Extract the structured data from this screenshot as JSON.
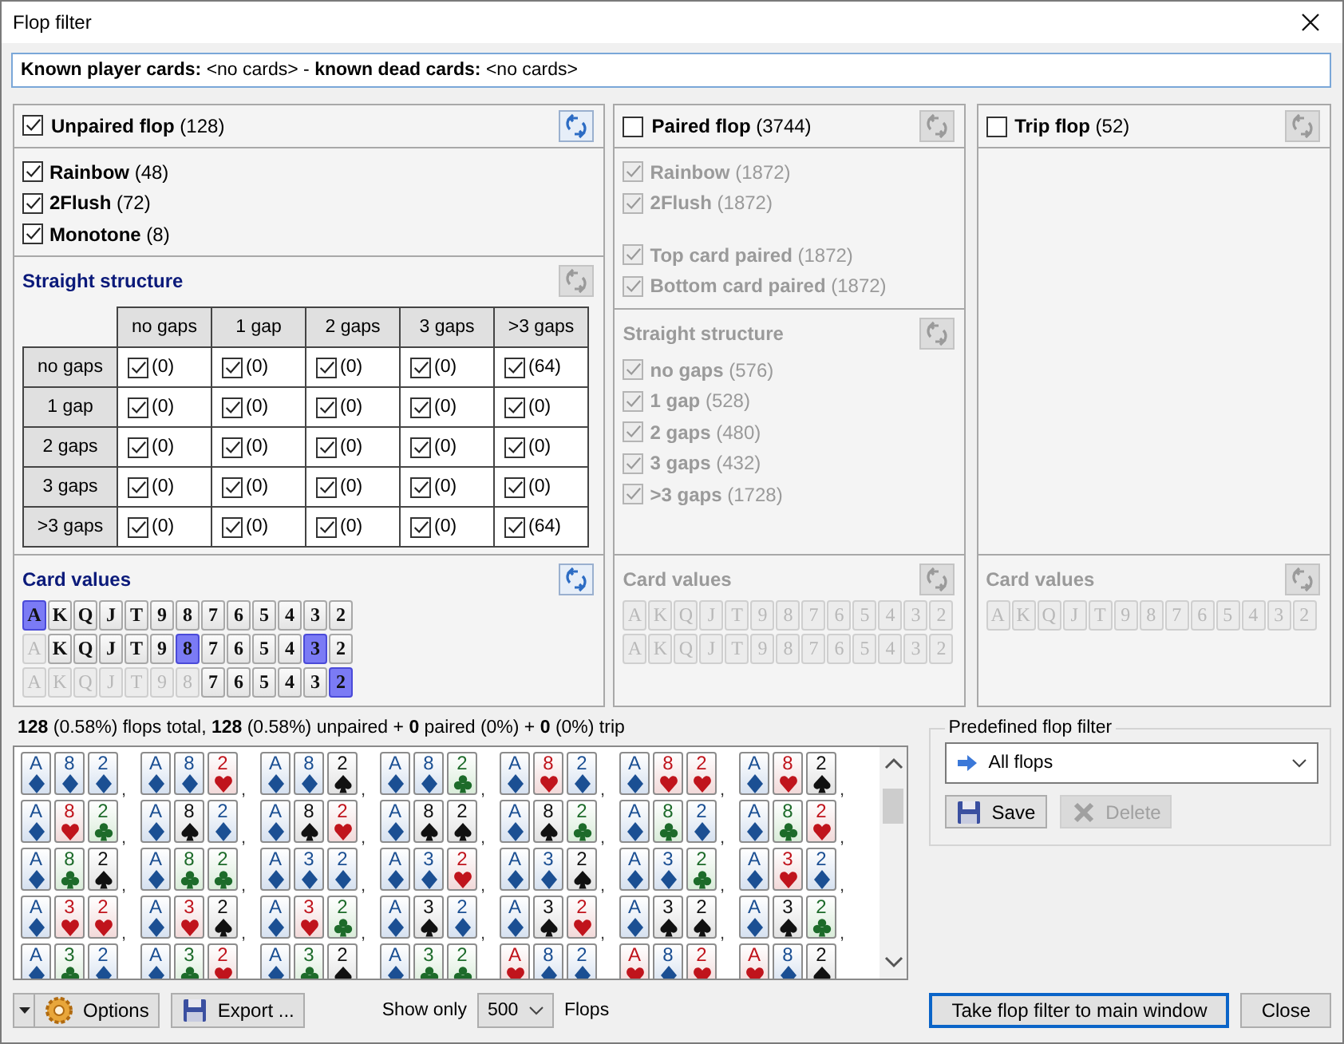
{
  "window": {
    "title": "Flop filter"
  },
  "known_cards": "**Known player cards:** <no cards> - **known dead cards:** <no cards>",
  "panels": [
    {
      "title": "Unpaired flop",
      "count": "(128)",
      "checked": true,
      "refresh_disabled": false,
      "option_groups": [
        [
          {
            "label": "Rainbow",
            "count": "(48)",
            "checked": true,
            "disabled": false
          },
          {
            "label": "2Flush",
            "count": "(72)",
            "checked": true,
            "disabled": false
          },
          {
            "label": "Monotone",
            "count": "(8)",
            "checked": true,
            "disabled": false
          }
        ]
      ],
      "straight": {
        "kind": "grid",
        "title": "Straight structure",
        "disabled": false,
        "refresh_disabled": true,
        "columns": [
          "no gaps",
          "1 gap",
          "2 gaps",
          "3 gaps",
          ">3 gaps"
        ],
        "rows": [
          {
            "label": "no gaps",
            "cells": [
              {
                "checked": true,
                "count": "(0)"
              },
              {
                "checked": true,
                "count": "(0)"
              },
              {
                "checked": true,
                "count": "(0)"
              },
              {
                "checked": true,
                "count": "(0)"
              },
              {
                "checked": true,
                "count": "(64)"
              }
            ]
          },
          {
            "label": "1 gap",
            "cells": [
              {
                "checked": true,
                "count": "(0)"
              },
              {
                "checked": true,
                "count": "(0)"
              },
              {
                "checked": true,
                "count": "(0)"
              },
              {
                "checked": true,
                "count": "(0)"
              },
              {
                "checked": true,
                "count": "(0)"
              }
            ]
          },
          {
            "label": "2 gaps",
            "cells": [
              {
                "checked": true,
                "count": "(0)"
              },
              {
                "checked": true,
                "count": "(0)"
              },
              {
                "checked": true,
                "count": "(0)"
              },
              {
                "checked": true,
                "count": "(0)"
              },
              {
                "checked": true,
                "count": "(0)"
              }
            ]
          },
          {
            "label": "3 gaps",
            "cells": [
              {
                "checked": true,
                "count": "(0)"
              },
              {
                "checked": true,
                "count": "(0)"
              },
              {
                "checked": true,
                "count": "(0)"
              },
              {
                "checked": true,
                "count": "(0)"
              },
              {
                "checked": true,
                "count": "(0)"
              }
            ]
          },
          {
            "label": ">3 gaps",
            "cells": [
              {
                "checked": true,
                "count": "(0)"
              },
              {
                "checked": true,
                "count": "(0)"
              },
              {
                "checked": true,
                "count": "(0)"
              },
              {
                "checked": true,
                "count": "(0)"
              },
              {
                "checked": true,
                "count": "(64)"
              }
            ]
          }
        ]
      },
      "card_values": {
        "title": "Card values",
        "disabled": false,
        "refresh_disabled": false,
        "rows": [
          [
            {
              "label": "A",
              "selected": true,
              "disabled": false
            },
            {
              "label": "K",
              "selected": false,
              "disabled": false
            },
            {
              "label": "Q",
              "selected": false,
              "disabled": false
            },
            {
              "label": "J",
              "selected": false,
              "disabled": false
            },
            {
              "label": "T",
              "selected": false,
              "disabled": false
            },
            {
              "label": "9",
              "selected": false,
              "disabled": false
            },
            {
              "label": "8",
              "selected": false,
              "disabled": false
            },
            {
              "label": "7",
              "selected": false,
              "disabled": false
            },
            {
              "label": "6",
              "selected": false,
              "disabled": false
            },
            {
              "label": "5",
              "selected": false,
              "disabled": false
            },
            {
              "label": "4",
              "selected": false,
              "disabled": false
            },
            {
              "label": "3",
              "selected": false,
              "disabled": false
            },
            {
              "label": "2",
              "selected": false,
              "disabled": false
            }
          ],
          [
            {
              "label": "A",
              "selected": false,
              "disabled": true
            },
            {
              "label": "K",
              "selected": false,
              "disabled": false
            },
            {
              "label": "Q",
              "selected": false,
              "disabled": false
            },
            {
              "label": "J",
              "selected": false,
              "disabled": false
            },
            {
              "label": "T",
              "selected": false,
              "disabled": false
            },
            {
              "label": "9",
              "selected": false,
              "disabled": false
            },
            {
              "label": "8",
              "selected": true,
              "disabled": false
            },
            {
              "label": "7",
              "selected": false,
              "disabled": false
            },
            {
              "label": "6",
              "selected": false,
              "disabled": false
            },
            {
              "label": "5",
              "selected": false,
              "disabled": false
            },
            {
              "label": "4",
              "selected": false,
              "disabled": false
            },
            {
              "label": "3",
              "selected": true,
              "disabled": false
            },
            {
              "label": "2",
              "selected": false,
              "disabled": false
            }
          ],
          [
            {
              "label": "A",
              "selected": false,
              "disabled": true
            },
            {
              "label": "K",
              "selected": false,
              "disabled": true
            },
            {
              "label": "Q",
              "selected": false,
              "disabled": true
            },
            {
              "label": "J",
              "selected": false,
              "disabled": true
            },
            {
              "label": "T",
              "selected": false,
              "disabled": true
            },
            {
              "label": "9",
              "selected": false,
              "disabled": true
            },
            {
              "label": "8",
              "selected": false,
              "disabled": true
            },
            {
              "label": "7",
              "selected": false,
              "disabled": false
            },
            {
              "label": "6",
              "selected": false,
              "disabled": false
            },
            {
              "label": "5",
              "selected": false,
              "disabled": false
            },
            {
              "label": "4",
              "selected": false,
              "disabled": false
            },
            {
              "label": "3",
              "selected": false,
              "disabled": false
            },
            {
              "label": "2",
              "selected": true,
              "disabled": false
            }
          ]
        ]
      }
    },
    {
      "title": "Paired flop",
      "count": "(3744)",
      "checked": false,
      "refresh_disabled": true,
      "option_groups": [
        [
          {
            "label": "Rainbow",
            "count": "(1872)",
            "checked": true,
            "disabled": true
          },
          {
            "label": "2Flush",
            "count": "(1872)",
            "checked": true,
            "disabled": true
          }
        ],
        [
          {
            "label": "Top card paired",
            "count": "(1872)",
            "checked": true,
            "disabled": true
          },
          {
            "label": "Bottom card paired",
            "count": "(1872)",
            "checked": true,
            "disabled": true
          }
        ]
      ],
      "straight": {
        "kind": "list",
        "title": "Straight structure",
        "disabled": true,
        "refresh_disabled": true,
        "items": [
          {
            "label": "no gaps",
            "count": "(576)",
            "checked": true,
            "disabled": true
          },
          {
            "label": "1 gap",
            "count": "(528)",
            "checked": true,
            "disabled": true
          },
          {
            "label": "2 gaps",
            "count": "(480)",
            "checked": true,
            "disabled": true
          },
          {
            "label": "3 gaps",
            "count": "(432)",
            "checked": true,
            "disabled": true
          },
          {
            "label": ">3 gaps",
            "count": "(1728)",
            "checked": true,
            "disabled": true
          }
        ]
      },
      "card_values": {
        "title": "Card values",
        "disabled": true,
        "refresh_disabled": true,
        "rows": [
          [
            {
              "label": "A",
              "selected": false,
              "disabled": true
            },
            {
              "label": "K",
              "selected": false,
              "disabled": true
            },
            {
              "label": "Q",
              "selected": false,
              "disabled": true
            },
            {
              "label": "J",
              "selected": false,
              "disabled": true
            },
            {
              "label": "T",
              "selected": false,
              "disabled": true
            },
            {
              "label": "9",
              "selected": false,
              "disabled": true
            },
            {
              "label": "8",
              "selected": false,
              "disabled": true
            },
            {
              "label": "7",
              "selected": false,
              "disabled": true
            },
            {
              "label": "6",
              "selected": false,
              "disabled": true
            },
            {
              "label": "5",
              "selected": false,
              "disabled": true
            },
            {
              "label": "4",
              "selected": false,
              "disabled": true
            },
            {
              "label": "3",
              "selected": false,
              "disabled": true
            },
            {
              "label": "2",
              "selected": false,
              "disabled": true
            }
          ],
          [
            {
              "label": "A",
              "selected": false,
              "disabled": true
            },
            {
              "label": "K",
              "selected": false,
              "disabled": true
            },
            {
              "label": "Q",
              "selected": false,
              "disabled": true
            },
            {
              "label": "J",
              "selected": false,
              "disabled": true
            },
            {
              "label": "T",
              "selected": false,
              "disabled": true
            },
            {
              "label": "9",
              "selected": false,
              "disabled": true
            },
            {
              "label": "8",
              "selected": false,
              "disabled": true
            },
            {
              "label": "7",
              "selected": false,
              "disabled": true
            },
            {
              "label": "6",
              "selected": false,
              "disabled": true
            },
            {
              "label": "5",
              "selected": false,
              "disabled": true
            },
            {
              "label": "4",
              "selected": false,
              "disabled": true
            },
            {
              "label": "3",
              "selected": false,
              "disabled": true
            },
            {
              "label": "2",
              "selected": false,
              "disabled": true
            }
          ]
        ]
      }
    },
    {
      "title": "Trip flop",
      "count": "(52)",
      "checked": false,
      "refresh_disabled": true,
      "card_values": {
        "title": "Card values",
        "disabled": true,
        "refresh_disabled": true,
        "rows": [
          [
            {
              "label": "A",
              "selected": false,
              "disabled": true
            },
            {
              "label": "K",
              "selected": false,
              "disabled": true
            },
            {
              "label": "Q",
              "selected": false,
              "disabled": true
            },
            {
              "label": "J",
              "selected": false,
              "disabled": true
            },
            {
              "label": "T",
              "selected": false,
              "disabled": true
            },
            {
              "label": "9",
              "selected": false,
              "disabled": true
            },
            {
              "label": "8",
              "selected": false,
              "disabled": true
            },
            {
              "label": "7",
              "selected": false,
              "disabled": true
            },
            {
              "label": "6",
              "selected": false,
              "disabled": true
            },
            {
              "label": "5",
              "selected": false,
              "disabled": true
            },
            {
              "label": "4",
              "selected": false,
              "disabled": true
            },
            {
              "label": "3",
              "selected": false,
              "disabled": true
            },
            {
              "label": "2",
              "selected": false,
              "disabled": true
            }
          ]
        ]
      }
    }
  ],
  "summary": "**128** (0.58%) flops total, **128** (0.58%) unpaired + **0** paired (0%) + **0** (0%) trip",
  "flop_list": {
    "rows": [
      [
        {
          "separator": ",",
          "cards": [
            {
              "rank": "A",
              "kind": "diamond"
            },
            {
              "rank": "8",
              "kind": "diamond"
            },
            {
              "rank": "2",
              "kind": "diamond"
            }
          ]
        },
        {
          "separator": ",",
          "cards": [
            {
              "rank": "A",
              "kind": "diamond"
            },
            {
              "rank": "8",
              "kind": "diamond"
            },
            {
              "rank": "2",
              "kind": "heart"
            }
          ]
        },
        {
          "separator": ",",
          "cards": [
            {
              "rank": "A",
              "kind": "diamond"
            },
            {
              "rank": "8",
              "kind": "diamond"
            },
            {
              "rank": "2",
              "kind": "spade"
            }
          ]
        },
        {
          "separator": ",",
          "cards": [
            {
              "rank": "A",
              "kind": "diamond"
            },
            {
              "rank": "8",
              "kind": "diamond"
            },
            {
              "rank": "2",
              "kind": "club"
            }
          ]
        },
        {
          "separator": ",",
          "cards": [
            {
              "rank": "A",
              "kind": "diamond"
            },
            {
              "rank": "8",
              "kind": "heart"
            },
            {
              "rank": "2",
              "kind": "diamond"
            }
          ]
        },
        {
          "separator": ",",
          "cards": [
            {
              "rank": "A",
              "kind": "diamond"
            },
            {
              "rank": "8",
              "kind": "heart"
            },
            {
              "rank": "2",
              "kind": "heart"
            }
          ]
        },
        {
          "separator": ",",
          "cards": [
            {
              "rank": "A",
              "kind": "diamond"
            },
            {
              "rank": "8",
              "kind": "heart"
            },
            {
              "rank": "2",
              "kind": "spade"
            }
          ]
        }
      ],
      [
        {
          "separator": ",",
          "cards": [
            {
              "rank": "A",
              "kind": "diamond"
            },
            {
              "rank": "8",
              "kind": "heart"
            },
            {
              "rank": "2",
              "kind": "club"
            }
          ]
        },
        {
          "separator": ",",
          "cards": [
            {
              "rank": "A",
              "kind": "diamond"
            },
            {
              "rank": "8",
              "kind": "spade"
            },
            {
              "rank": "2",
              "kind": "diamond"
            }
          ]
        },
        {
          "separator": ",",
          "cards": [
            {
              "rank": "A",
              "kind": "diamond"
            },
            {
              "rank": "8",
              "kind": "spade"
            },
            {
              "rank": "2",
              "kind": "heart"
            }
          ]
        },
        {
          "separator": ",",
          "cards": [
            {
              "rank": "A",
              "kind": "diamond"
            },
            {
              "rank": "8",
              "kind": "spade"
            },
            {
              "rank": "2",
              "kind": "spade"
            }
          ]
        },
        {
          "separator": ",",
          "cards": [
            {
              "rank": "A",
              "kind": "diamond"
            },
            {
              "rank": "8",
              "kind": "spade"
            },
            {
              "rank": "2",
              "kind": "club"
            }
          ]
        },
        {
          "separator": ",",
          "cards": [
            {
              "rank": "A",
              "kind": "diamond"
            },
            {
              "rank": "8",
              "kind": "club"
            },
            {
              "rank": "2",
              "kind": "diamond"
            }
          ]
        },
        {
          "separator": ",",
          "cards": [
            {
              "rank": "A",
              "kind": "diamond"
            },
            {
              "rank": "8",
              "kind": "club"
            },
            {
              "rank": "2",
              "kind": "heart"
            }
          ]
        }
      ],
      [
        {
          "separator": ",",
          "cards": [
            {
              "rank": "A",
              "kind": "diamond"
            },
            {
              "rank": "8",
              "kind": "club"
            },
            {
              "rank": "2",
              "kind": "spade"
            }
          ]
        },
        {
          "separator": ",",
          "cards": [
            {
              "rank": "A",
              "kind": "diamond"
            },
            {
              "rank": "8",
              "kind": "club"
            },
            {
              "rank": "2",
              "kind": "club"
            }
          ]
        },
        {
          "separator": ",",
          "cards": [
            {
              "rank": "A",
              "kind": "diamond"
            },
            {
              "rank": "3",
              "kind": "diamond"
            },
            {
              "rank": "2",
              "kind": "diamond"
            }
          ]
        },
        {
          "separator": ",",
          "cards": [
            {
              "rank": "A",
              "kind": "diamond"
            },
            {
              "rank": "3",
              "kind": "diamond"
            },
            {
              "rank": "2",
              "kind": "heart"
            }
          ]
        },
        {
          "separator": ",",
          "cards": [
            {
              "rank": "A",
              "kind": "diamond"
            },
            {
              "rank": "3",
              "kind": "diamond"
            },
            {
              "rank": "2",
              "kind": "spade"
            }
          ]
        },
        {
          "separator": ",",
          "cards": [
            {
              "rank": "A",
              "kind": "diamond"
            },
            {
              "rank": "3",
              "kind": "diamond"
            },
            {
              "rank": "2",
              "kind": "club"
            }
          ]
        },
        {
          "separator": ",",
          "cards": [
            {
              "rank": "A",
              "kind": "diamond"
            },
            {
              "rank": "3",
              "kind": "heart"
            },
            {
              "rank": "2",
              "kind": "diamond"
            }
          ]
        }
      ],
      [
        {
          "separator": ",",
          "cards": [
            {
              "rank": "A",
              "kind": "diamond"
            },
            {
              "rank": "3",
              "kind": "heart"
            },
            {
              "rank": "2",
              "kind": "heart"
            }
          ]
        },
        {
          "separator": ",",
          "cards": [
            {
              "rank": "A",
              "kind": "diamond"
            },
            {
              "rank": "3",
              "kind": "heart"
            },
            {
              "rank": "2",
              "kind": "spade"
            }
          ]
        },
        {
          "separator": ",",
          "cards": [
            {
              "rank": "A",
              "kind": "diamond"
            },
            {
              "rank": "3",
              "kind": "heart"
            },
            {
              "rank": "2",
              "kind": "club"
            }
          ]
        },
        {
          "separator": ",",
          "cards": [
            {
              "rank": "A",
              "kind": "diamond"
            },
            {
              "rank": "3",
              "kind": "spade"
            },
            {
              "rank": "2",
              "kind": "diamond"
            }
          ]
        },
        {
          "separator": ",",
          "cards": [
            {
              "rank": "A",
              "kind": "diamond"
            },
            {
              "rank": "3",
              "kind": "spade"
            },
            {
              "rank": "2",
              "kind": "heart"
            }
          ]
        },
        {
          "separator": ",",
          "cards": [
            {
              "rank": "A",
              "kind": "diamond"
            },
            {
              "rank": "3",
              "kind": "spade"
            },
            {
              "rank": "2",
              "kind": "spade"
            }
          ]
        },
        {
          "separator": ",",
          "cards": [
            {
              "rank": "A",
              "kind": "diamond"
            },
            {
              "rank": "3",
              "kind": "spade"
            },
            {
              "rank": "2",
              "kind": "club"
            }
          ]
        }
      ],
      [
        {
          "cards": [
            {
              "rank": "A",
              "kind": "diamond"
            },
            {
              "rank": "3",
              "kind": "club"
            },
            {
              "rank": "2",
              "kind": "diamond"
            }
          ]
        },
        {
          "cards": [
            {
              "rank": "A",
              "kind": "diamond"
            },
            {
              "rank": "3",
              "kind": "club"
            },
            {
              "rank": "2",
              "kind": "heart"
            }
          ]
        },
        {
          "cards": [
            {
              "rank": "A",
              "kind": "diamond"
            },
            {
              "rank": "3",
              "kind": "club"
            },
            {
              "rank": "2",
              "kind": "spade"
            }
          ]
        },
        {
          "cards": [
            {
              "rank": "A",
              "kind": "diamond"
            },
            {
              "rank": "3",
              "kind": "club"
            },
            {
              "rank": "2",
              "kind": "club"
            }
          ]
        },
        {
          "cards": [
            {
              "rank": "A",
              "kind": "heart"
            },
            {
              "rank": "8",
              "kind": "diamond"
            },
            {
              "rank": "2",
              "kind": "diamond"
            }
          ]
        },
        {
          "cards": [
            {
              "rank": "A",
              "kind": "heart"
            },
            {
              "rank": "8",
              "kind": "diamond"
            },
            {
              "rank": "2",
              "kind": "heart"
            }
          ]
        },
        {
          "cards": [
            {
              "rank": "A",
              "kind": "heart"
            },
            {
              "rank": "8",
              "kind": "diamond"
            },
            {
              "rank": "2",
              "kind": "spade"
            }
          ]
        }
      ]
    ]
  },
  "predefined": {
    "title": "Predefined flop filter",
    "value": "All flops",
    "buttons": [
      {
        "label": "Save",
        "kind": "save",
        "disabled": false
      },
      {
        "label": "Delete",
        "kind": "delete",
        "disabled": true
      }
    ]
  },
  "bottom": {
    "options": "Options",
    "export": "Export ...",
    "show_only": {
      "label": "Show only",
      "value": "500",
      "suffix": "Flops"
    },
    "take": "Take flop filter to main window",
    "close": "Close"
  }
}
